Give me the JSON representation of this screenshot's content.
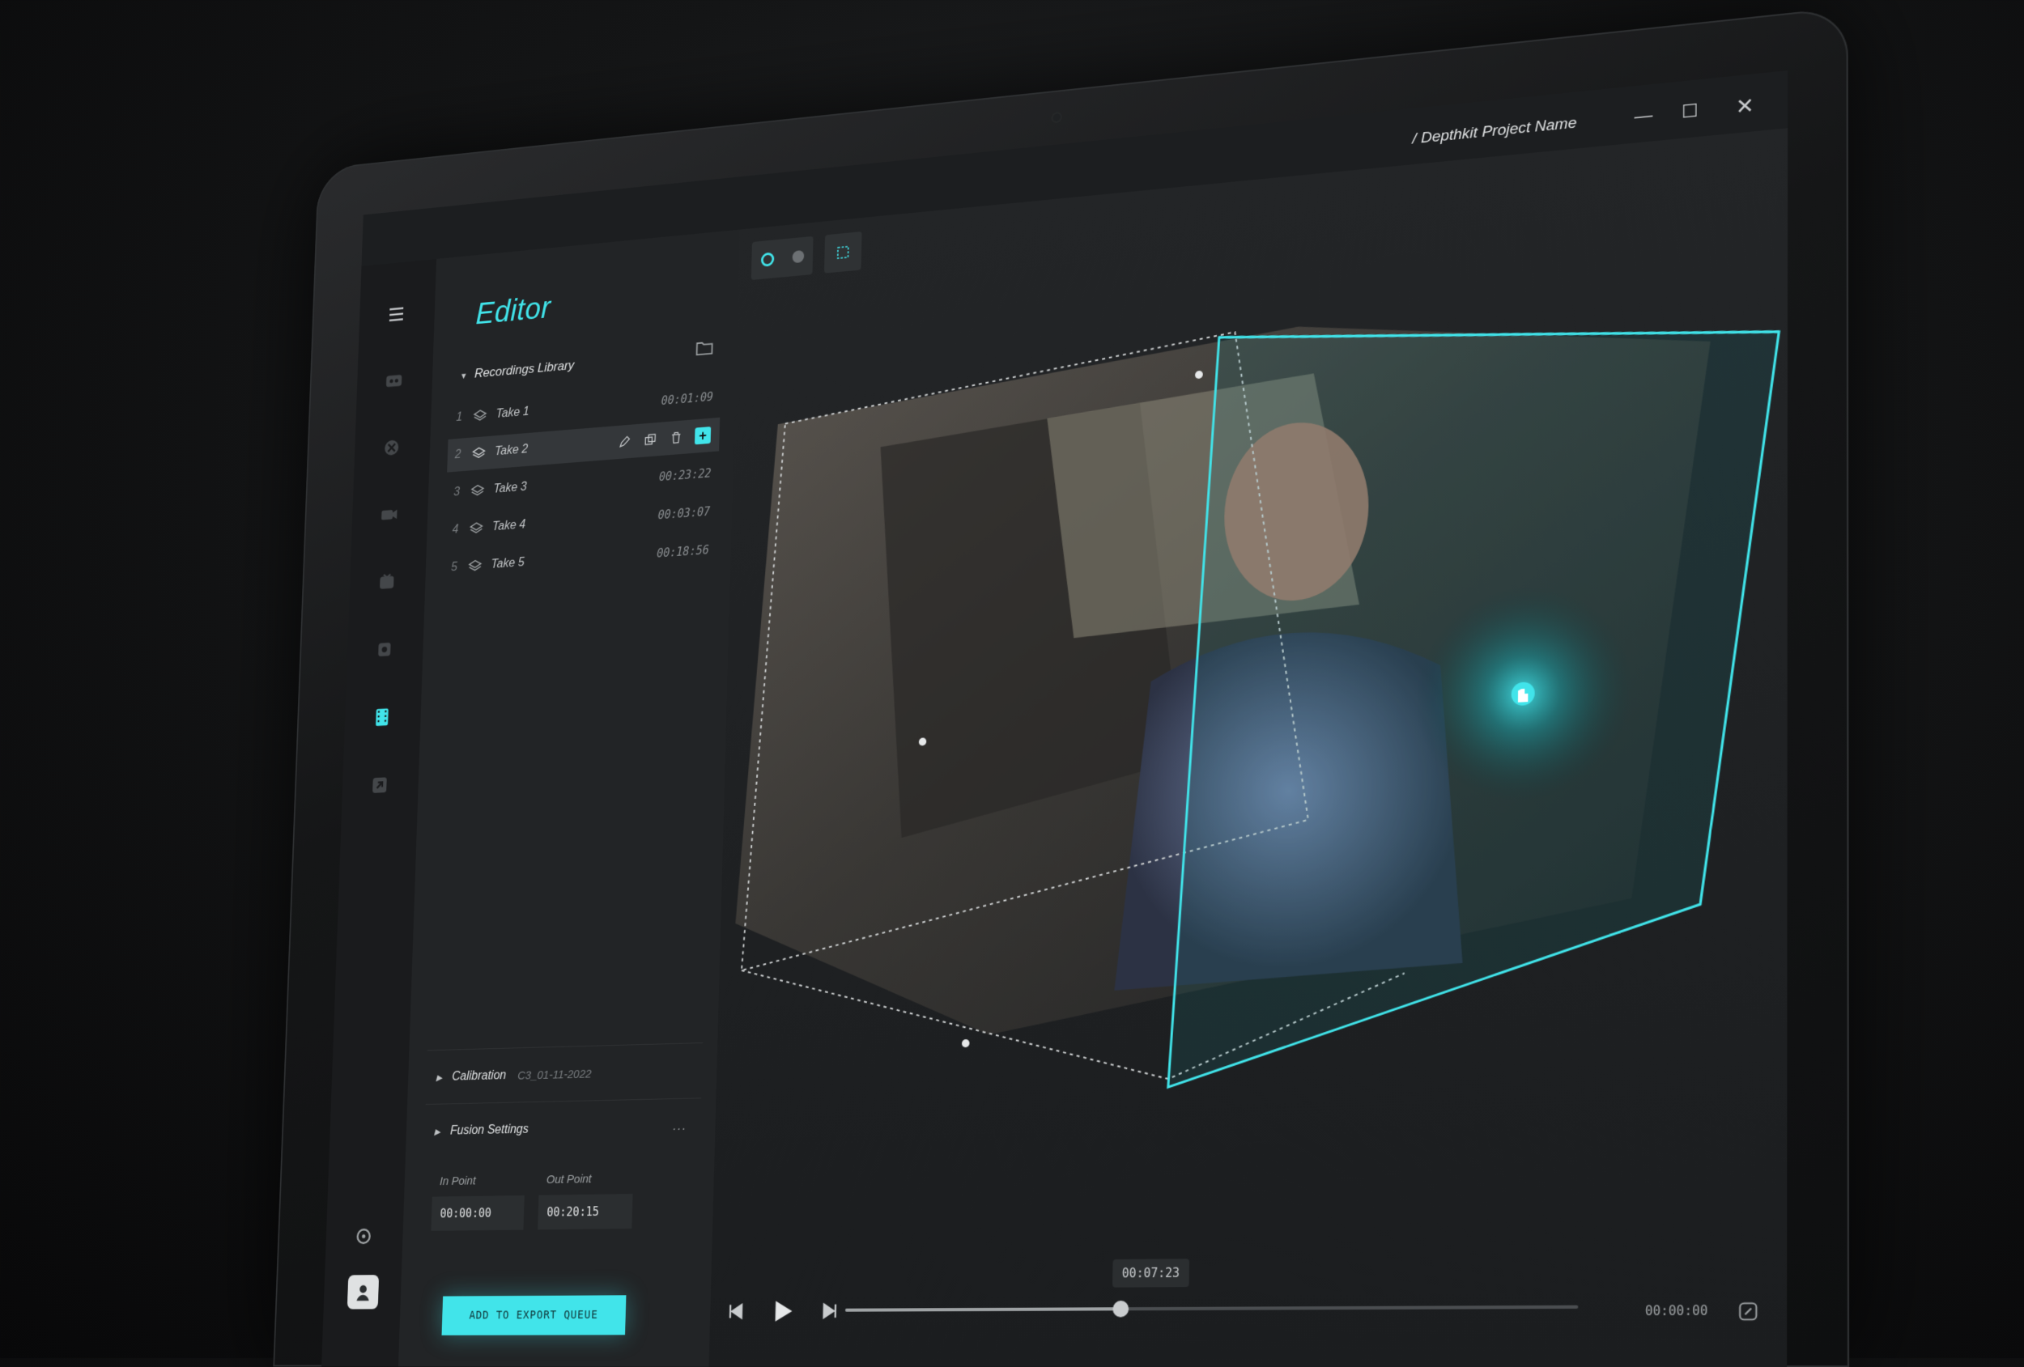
{
  "window": {
    "project_name": "/ Depthkit Project Name",
    "minimize_glyph": "—",
    "maximize_glyph": "☐",
    "close_glyph": "✕"
  },
  "rail": {
    "icons": [
      "menu-icon",
      "record-icon",
      "sensor-icon",
      "camera-icon",
      "calibration-icon",
      "stop-icon",
      "film-icon",
      "export-icon",
      "settings-icon",
      "avatar"
    ],
    "active": "film-icon"
  },
  "editor": {
    "title": "Editor",
    "library": {
      "label": "Recordings Library",
      "takes": [
        {
          "num": "1",
          "name": "Take 1",
          "duration": "00:01:09"
        },
        {
          "num": "2",
          "name": "Take 2",
          "duration": ""
        },
        {
          "num": "3",
          "name": "Take 3",
          "duration": "00:23:22"
        },
        {
          "num": "4",
          "name": "Take 4",
          "duration": "00:03:07"
        },
        {
          "num": "5",
          "name": "Take 5",
          "duration": "00:18:56"
        }
      ],
      "selected_index": 1,
      "add_glyph": "+"
    },
    "calibration": {
      "label": "Calibration",
      "value": "C3_01-11-2022"
    },
    "fusion": {
      "label": "Fusion Settings",
      "more": "..."
    },
    "in_point": {
      "label": "In Point",
      "value": "00:00:00"
    },
    "out_point": {
      "label": "Out Point",
      "value": "00:20:15"
    },
    "export_button": "ADD TO EXPORT QUEUE"
  },
  "viewport": {
    "current_time": "00:07:23",
    "end_time": "00:00:00",
    "progress": 0.39
  },
  "colors": {
    "accent": "#41e4ea",
    "panel": "#222426",
    "rail": "#1a1b1d"
  }
}
